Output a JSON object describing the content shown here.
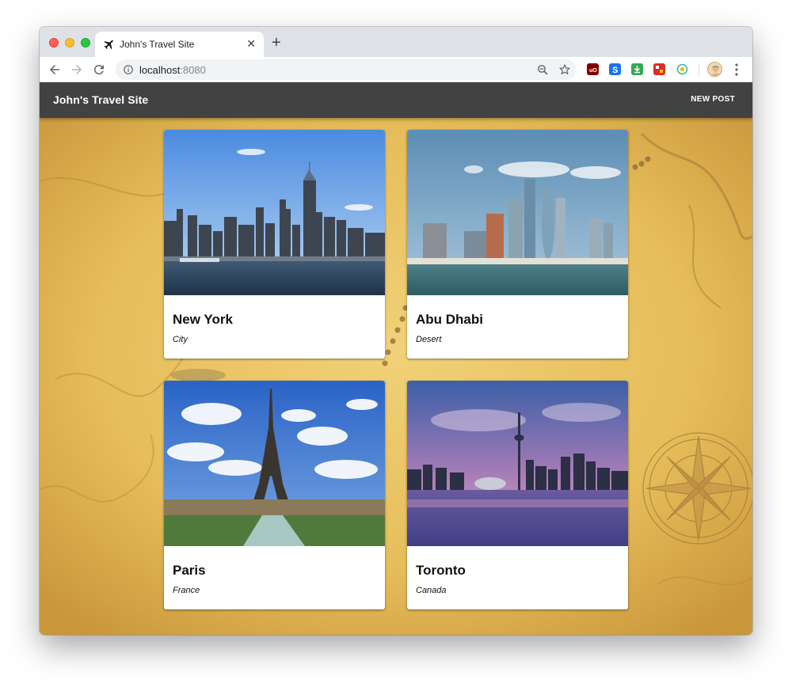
{
  "browser": {
    "tab_title": "John's Travel Site",
    "tab_favicon": "airplane-icon",
    "url_host": "localhost",
    "url_port": ":8080",
    "colors": {
      "tabstrip": "#dee1e6",
      "omnibox": "#f1f3f4"
    }
  },
  "app": {
    "title": "John's Travel Site",
    "new_post_label": "NEW POST",
    "appbar_color": "#424242"
  },
  "posts": [
    {
      "title": "New York",
      "subtitle": "City"
    },
    {
      "title": "Abu Dhabi",
      "subtitle": "Desert"
    },
    {
      "title": "Paris",
      "subtitle": "France"
    },
    {
      "title": "Toronto",
      "subtitle": "Canada"
    }
  ]
}
